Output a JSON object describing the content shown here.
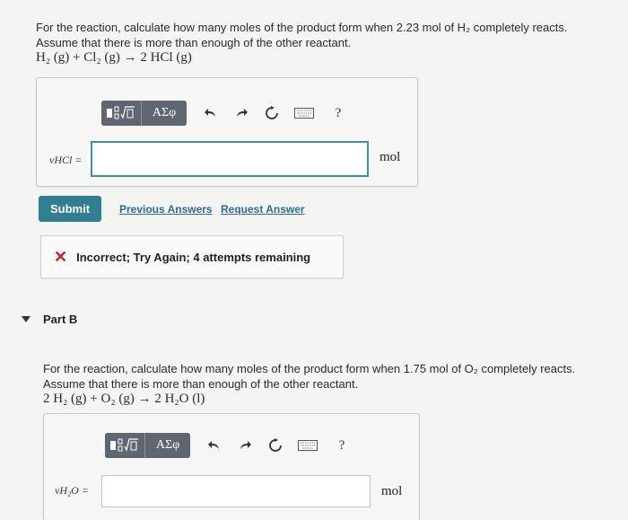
{
  "part_a": {
    "question_line1": "For the reaction, calculate how many moles of the product form when 2.23 mol of H₂ completely reacts.",
    "question_line2": "Assume that there is more than enough of the other reactant.",
    "equation": "H₂ (g) + Cl₂ (g) → 2 HCl (g)",
    "variable_label": "νHCl =",
    "unit": "mol",
    "input_value": "",
    "toolbar": {
      "templates_icon": "fraction-sqrt-templates-icon",
      "greek_label": "ΑΣφ",
      "undo_icon": "undo-icon",
      "redo_icon": "redo-icon",
      "reset_icon": "reset-icon",
      "keyboard_icon": "keyboard-icon",
      "help_label": "?"
    },
    "submit_label": "Submit",
    "previous_answers_label": "Previous Answers",
    "request_answer_label": "Request Answer",
    "feedback_text": "Incorrect; Try Again; 4 attempts remaining"
  },
  "part_b": {
    "title": "Part B",
    "question_line1": "For the reaction, calculate how many moles of the product form when 1.75 mol of O₂ completely reacts.",
    "question_line2": "Assume that there is more than enough of the other reactant.",
    "equation": "2 H₂ (g) + O₂ (g) → 2 H₂O (l)",
    "variable_label": "νH₂O =",
    "unit": "mol",
    "input_value": "",
    "toolbar": {
      "greek_label": "ΑΣφ",
      "help_label": "?"
    }
  },
  "colors": {
    "accent": "#2f7f91",
    "input_border": "#3a93a6",
    "error": "#c8201e",
    "link": "#2a6f8f"
  }
}
